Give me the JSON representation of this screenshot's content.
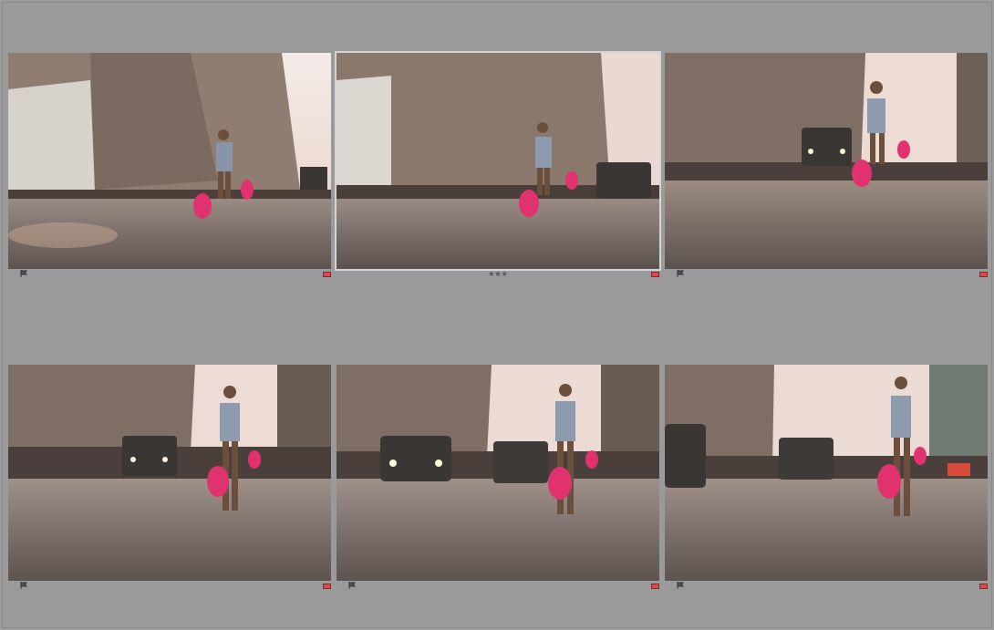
{
  "grid": {
    "cells": [
      {
        "rating": "",
        "color_label": "#e04a4a",
        "flag": "flag-icon",
        "scene": "street-man-walking-1"
      },
      {
        "rating": "★★★",
        "color_label": "#e04a4a",
        "flag": "",
        "scene": "street-man-walking-2"
      },
      {
        "rating": "",
        "color_label": "#e04a4a",
        "flag": "flag-icon",
        "scene": "street-man-walking-3"
      },
      {
        "rating": "",
        "color_label": "#e04a4a",
        "flag": "flag-icon",
        "scene": "street-man-walking-4"
      },
      {
        "rating": "",
        "color_label": "#e04a4a",
        "flag": "flag-icon",
        "scene": "street-man-walking-5"
      },
      {
        "rating": "",
        "color_label": "#e04a4a",
        "flag": "flag-icon",
        "scene": "street-man-walking-6"
      }
    ]
  },
  "theme": {
    "background": "#9a9a9a",
    "label_red": "#e04a4a"
  }
}
